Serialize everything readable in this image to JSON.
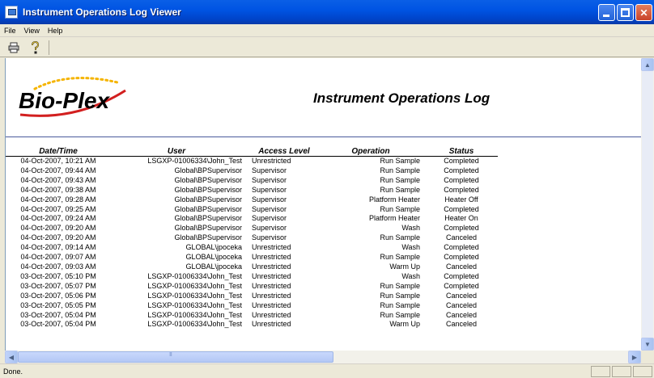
{
  "window": {
    "title": "Instrument Operations Log Viewer"
  },
  "menu": [
    {
      "label": "File"
    },
    {
      "label": "View"
    },
    {
      "label": "Help"
    }
  ],
  "toolbar": {
    "print_icon": "printer-icon",
    "help_icon": "help-icon"
  },
  "report": {
    "logo_text": "Bio-Plex",
    "title": "Instrument Operations Log",
    "columns": {
      "date": "Date/Time",
      "user": "User",
      "access": "Access Level",
      "operation": "Operation",
      "status": "Status"
    },
    "rows": [
      {
        "date": "04-Oct-2007, 10:21 AM",
        "user": "LSGXP-01006334\\John_Test",
        "access": "Unrestricted",
        "operation": "Run Sample",
        "status": "Completed"
      },
      {
        "date": "04-Oct-2007, 09:44 AM",
        "user": "Global\\BPSupervisor",
        "access": "Supervisor",
        "operation": "Run Sample",
        "status": "Completed"
      },
      {
        "date": "04-Oct-2007, 09:43 AM",
        "user": "Global\\BPSupervisor",
        "access": "Supervisor",
        "operation": "Run Sample",
        "status": "Completed"
      },
      {
        "date": "04-Oct-2007, 09:38 AM",
        "user": "Global\\BPSupervisor",
        "access": "Supervisor",
        "operation": "Run Sample",
        "status": "Completed"
      },
      {
        "date": "04-Oct-2007, 09:28 AM",
        "user": "Global\\BPSupervisor",
        "access": "Supervisor",
        "operation": "Platform Heater",
        "status": "Heater Off"
      },
      {
        "date": "04-Oct-2007, 09:25 AM",
        "user": "Global\\BPSupervisor",
        "access": "Supervisor",
        "operation": "Run Sample",
        "status": "Completed"
      },
      {
        "date": "04-Oct-2007, 09:24 AM",
        "user": "Global\\BPSupervisor",
        "access": "Supervisor",
        "operation": "Platform Heater",
        "status": "Heater On"
      },
      {
        "date": "04-Oct-2007, 09:20 AM",
        "user": "Global\\BPSupervisor",
        "access": "Supervisor",
        "operation": "Wash",
        "status": "Completed"
      },
      {
        "date": "04-Oct-2007, 09:20 AM",
        "user": "Global\\BPSupervisor",
        "access": "Supervisor",
        "operation": "Run Sample",
        "status": "Canceled"
      },
      {
        "date": "04-Oct-2007, 09:14 AM",
        "user": "GLOBAL\\jpoceka",
        "access": "Unrestricted",
        "operation": "Wash",
        "status": "Completed"
      },
      {
        "date": "04-Oct-2007, 09:07 AM",
        "user": "GLOBAL\\jpoceka",
        "access": "Unrestricted",
        "operation": "Run Sample",
        "status": "Completed"
      },
      {
        "date": "04-Oct-2007, 09:03 AM",
        "user": "GLOBAL\\jpoceka",
        "access": "Unrestricted",
        "operation": "Warm Up",
        "status": "Canceled"
      },
      {
        "date": "03-Oct-2007, 05:10 PM",
        "user": "LSGXP-01006334\\John_Test",
        "access": "Unrestricted",
        "operation": "Wash",
        "status": "Completed"
      },
      {
        "date": "03-Oct-2007, 05:07 PM",
        "user": "LSGXP-01006334\\John_Test",
        "access": "Unrestricted",
        "operation": "Run Sample",
        "status": "Completed"
      },
      {
        "date": "03-Oct-2007, 05:06 PM",
        "user": "LSGXP-01006334\\John_Test",
        "access": "Unrestricted",
        "operation": "Run Sample",
        "status": "Canceled"
      },
      {
        "date": "03-Oct-2007, 05:05 PM",
        "user": "LSGXP-01006334\\John_Test",
        "access": "Unrestricted",
        "operation": "Run Sample",
        "status": "Canceled"
      },
      {
        "date": "03-Oct-2007, 05:04 PM",
        "user": "LSGXP-01006334\\John_Test",
        "access": "Unrestricted",
        "operation": "Run Sample",
        "status": "Canceled"
      },
      {
        "date": "03-Oct-2007, 05:04 PM",
        "user": "LSGXP-01006334\\John_Test",
        "access": "Unrestricted",
        "operation": "Warm Up",
        "status": "Canceled"
      }
    ]
  },
  "status_bar": {
    "text": "Done."
  },
  "colors": {
    "titlebar": "#0054e3",
    "header_rule": "#4a5a9c",
    "logo_arc": "#f5b400"
  }
}
